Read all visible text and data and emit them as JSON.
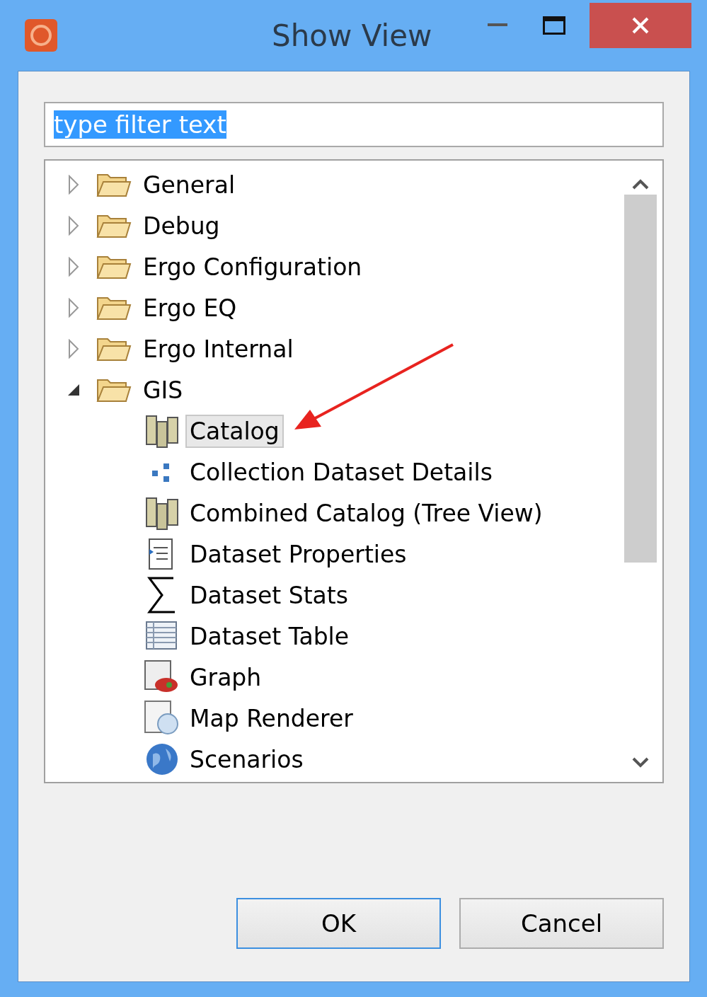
{
  "window": {
    "title": "Show View"
  },
  "filter": {
    "value": "type filter text",
    "text_selected": true
  },
  "tree": [
    {
      "label": "General",
      "expanded": false
    },
    {
      "label": "Debug",
      "expanded": false
    },
    {
      "label": "Ergo Configuration",
      "expanded": false
    },
    {
      "label": "Ergo EQ",
      "expanded": false
    },
    {
      "label": "Ergo Internal",
      "expanded": false
    },
    {
      "label": "GIS",
      "expanded": true,
      "children": [
        {
          "label": "Catalog",
          "kind": "catalog",
          "selected": true
        },
        {
          "label": "Collection Dataset Details",
          "kind": "collection",
          "selected": false
        },
        {
          "label": "Combined Catalog (Tree View)",
          "kind": "catalog",
          "selected": false
        },
        {
          "label": "Dataset Properties",
          "kind": "properties",
          "selected": false
        },
        {
          "label": "Dataset Stats",
          "kind": "stats",
          "selected": false
        },
        {
          "label": "Dataset Table",
          "kind": "table",
          "selected": false
        },
        {
          "label": "Graph",
          "kind": "graph",
          "selected": false
        },
        {
          "label": "Map Renderer",
          "kind": "map",
          "selected": false
        },
        {
          "label": "Scenarios",
          "kind": "globe",
          "selected": false
        }
      ]
    }
  ],
  "buttons": [
    {
      "label": "OK",
      "default": true
    },
    {
      "label": "Cancel",
      "default": false
    }
  ]
}
